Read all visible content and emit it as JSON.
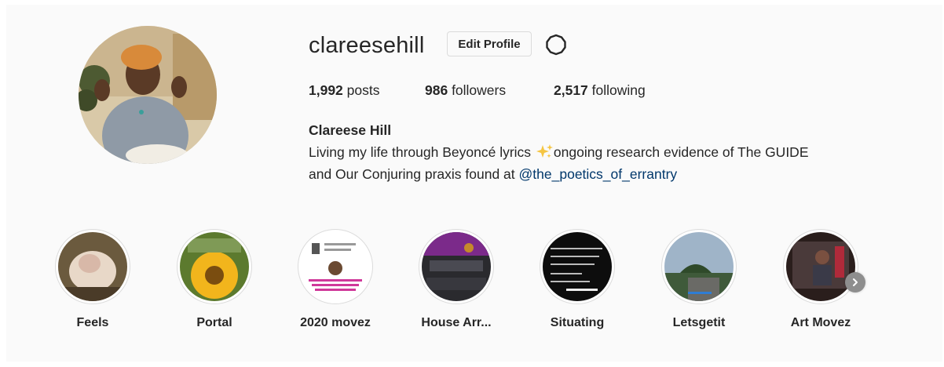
{
  "profile": {
    "username": "clareesehill",
    "edit_button": "Edit Profile",
    "stats": {
      "posts_count": "1,992",
      "posts_label": " posts",
      "followers_count": "986",
      "followers_label": " followers",
      "following_count": "2,517",
      "following_label": " following"
    },
    "bio": {
      "full_name": "Clareese Hill",
      "line1_before": "Living my life through Beyoncé lyrics ",
      "line1_after": "ongoing research evidence of The GUIDE",
      "line2_before": "and Our Conjuring praxis found at ",
      "mention": "@the_poetics_of_errantry"
    },
    "icons": {
      "settings": "gear-icon",
      "sparkles": "sparkles-emoji",
      "next": "chevron-right-icon"
    }
  },
  "highlights": [
    {
      "label": "Feels"
    },
    {
      "label": "Portal"
    },
    {
      "label": "2020 movez"
    },
    {
      "label": "House Arr..."
    },
    {
      "label": "Situating"
    },
    {
      "label": "Letsgetit"
    },
    {
      "label": "Art Movez"
    }
  ],
  "colors": {
    "accent_link": "#00376b",
    "panel_bg": "#fafafa",
    "border": "#dbdbdb"
  }
}
